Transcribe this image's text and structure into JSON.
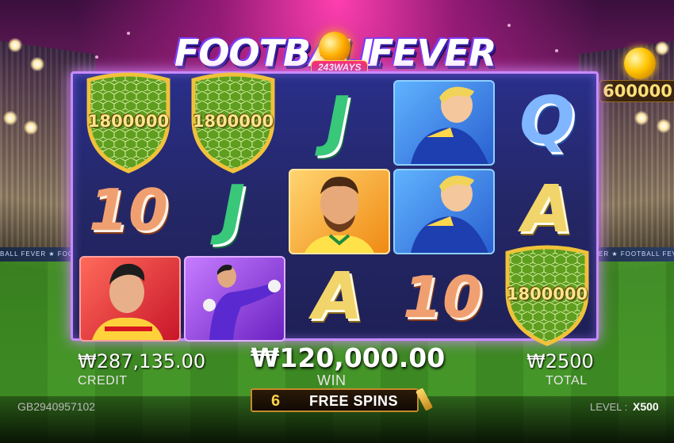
{
  "game": {
    "title_part1": "FOOTBALL",
    "title_part2": "FEVER",
    "ways_badge": "243WAYS",
    "jackpot_value": "600000",
    "banner_text": "BALL FEVER ★ FOOTBALL FEVER ★ FOOTBALL"
  },
  "reels": {
    "shield_value": "1800000",
    "grid": [
      [
        "shield",
        "J",
        "J",
        "A",
        "10"
      ],
      [],
      []
    ]
  },
  "symbols": {
    "j": "J",
    "q": "Q",
    "a": "A",
    "ten": "10",
    "shield_1": "1800000",
    "shield_2": "1800000",
    "shield_3": "1800000"
  },
  "stats": {
    "credit_value": "₩287,135.00",
    "credit_label": "CREDIT",
    "win_value": "₩120,000.00",
    "win_label": "WIN",
    "total_value": "₩2500",
    "total_label": "TOTAL"
  },
  "free_spins": {
    "count": "6",
    "label": "FREE SPINS"
  },
  "footer": {
    "session_id": "GB2940957102",
    "level_label": "LEVEL :",
    "level_value": "X500"
  },
  "colors": {
    "frame_border": "#c98bff",
    "gold_text": "#ffe58a",
    "j_green": "#39c77a",
    "q_blue": "#7fb6ff",
    "a_gold": "#f2d56a",
    "ten_orange": "#f0a070"
  }
}
